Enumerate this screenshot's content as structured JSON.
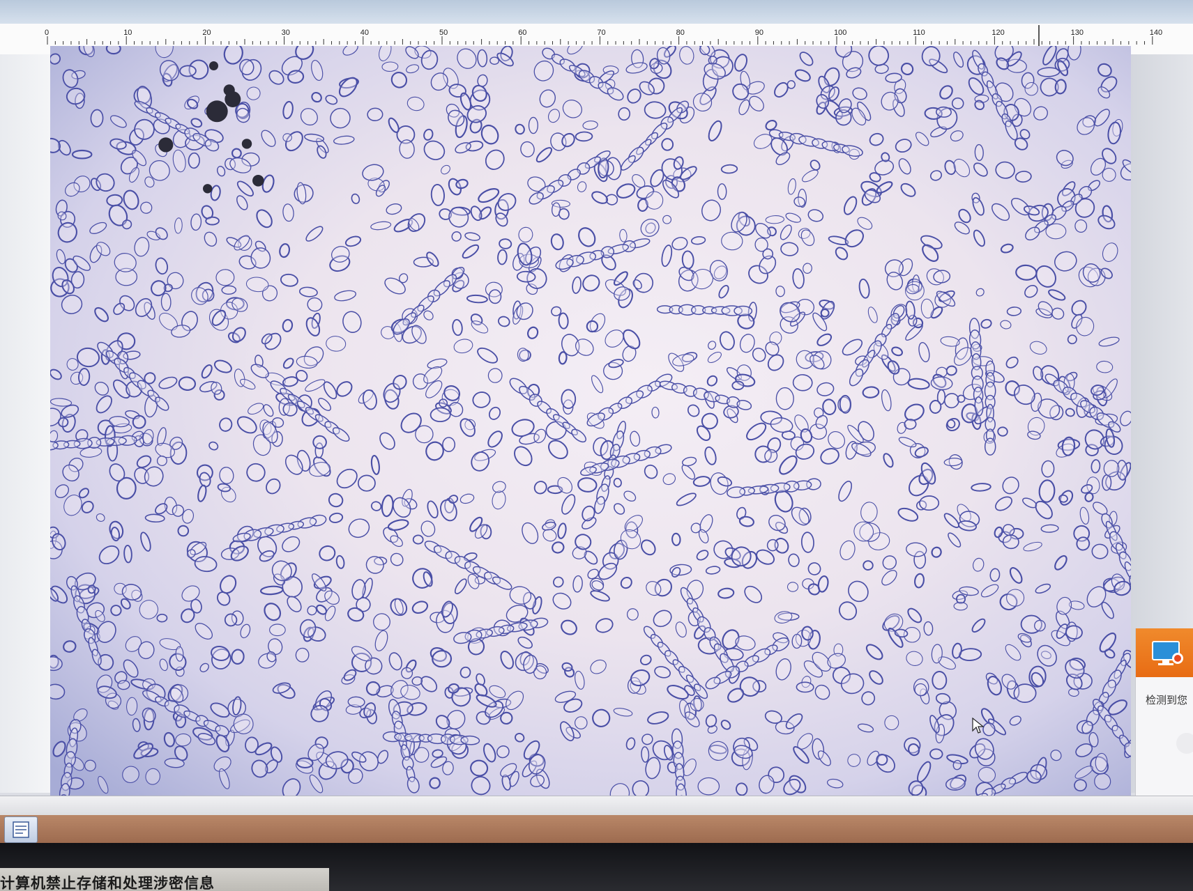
{
  "ruler": {
    "labels": [
      "0",
      "10",
      "20",
      "30",
      "40",
      "50",
      "60",
      "70",
      "80",
      "90",
      "100",
      "110",
      "120",
      "130",
      "140"
    ]
  },
  "popup": {
    "text": "检测到您"
  },
  "monitor_label": {
    "text": "计算机禁止存储和处理涉密信息"
  },
  "colors": {
    "grain_outline": "#4a4fa6",
    "background_center": "#f4eef5",
    "background_edge": "#a7acd6",
    "popup_orange": "#ea741b",
    "taskbar": "#a87559"
  }
}
